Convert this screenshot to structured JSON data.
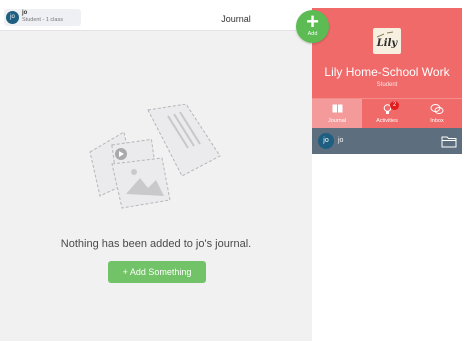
{
  "topbar": {
    "user": {
      "avatar_initials": "jo",
      "name": "jo",
      "subtitle": "Student - 1 class"
    },
    "title": "Journal"
  },
  "main": {
    "empty_message": "Nothing has been added to jo's journal.",
    "add_button_label": "+ Add Something"
  },
  "fab": {
    "icon": "plus-icon",
    "label": "Add"
  },
  "class_panel": {
    "logo_text": "Lily",
    "name": "Lily Home-School Work",
    "role": "Student",
    "tabs": [
      {
        "label": "Journal",
        "icon": "journal-book-icon",
        "active": true
      },
      {
        "label": "Activities",
        "icon": "lightbulb-icon",
        "badge": "2"
      },
      {
        "label": "Inbox",
        "icon": "chat-bubbles-icon"
      }
    ],
    "student": {
      "avatar_initials": "jo",
      "name": "jo",
      "icon": "folder-icon"
    }
  },
  "colors": {
    "accent_green": "#72c267",
    "class_red": "#f06a6a",
    "student_row": "#5d6e7e",
    "avatar_blue": "#1e5e80"
  }
}
